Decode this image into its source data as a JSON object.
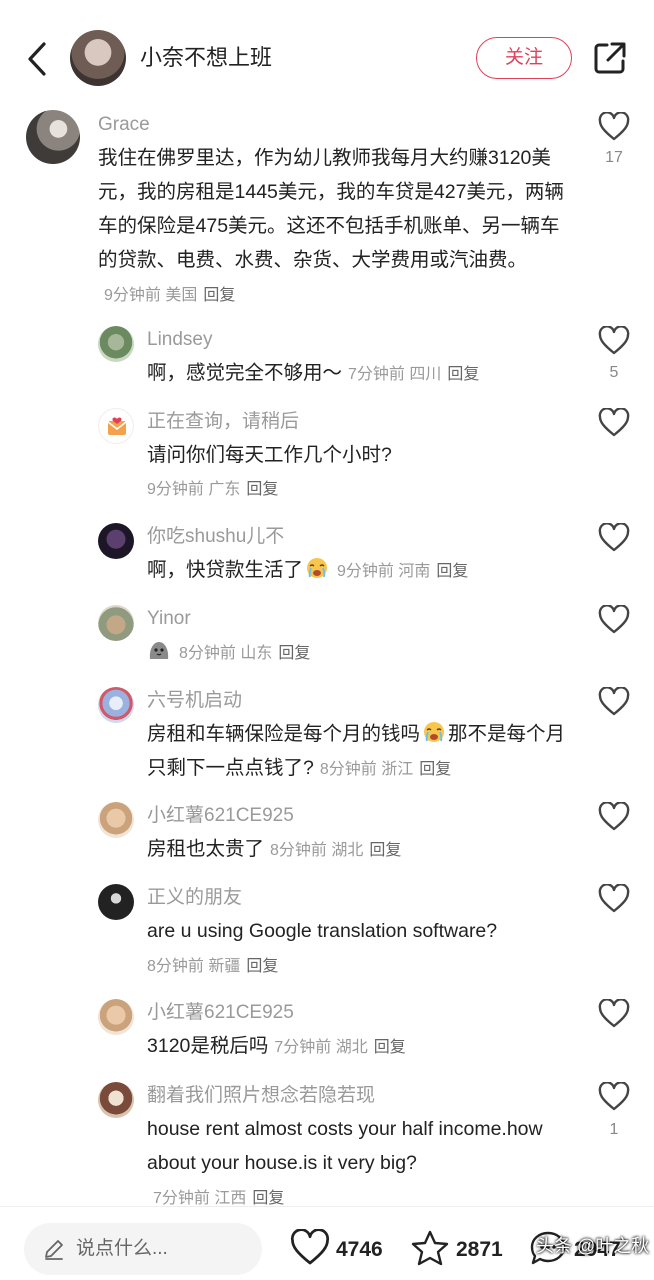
{
  "header": {
    "name": "小奈不想上班",
    "follow_label": "关注"
  },
  "comments": [
    {
      "user": "Grace",
      "text": "我住在佛罗里达，作为幼儿教师我每月大约赚3120美元，我的房租是1445美元，我的车贷是427美元，两辆车的保险是475美元。这还不包括手机账单、另一辆车的贷款、电费、水费、杂货、大学费用或汽油费。",
      "time": "9分钟前",
      "location": "美国",
      "reply": "回复",
      "likes": "17"
    },
    {
      "user": "Lindsey",
      "text": "啊，感觉完全不够用～",
      "time": "7分钟前",
      "location": "四川",
      "reply": "回复",
      "likes": "5"
    },
    {
      "user": "正在查询，请稍后",
      "text": "请问你们每天工作几个小时?",
      "time": "9分钟前",
      "location": "广东",
      "reply": "回复",
      "likes": ""
    },
    {
      "user": "你吃shushu儿不",
      "text": "啊，快贷款生活了",
      "emoji": "crying-face",
      "time": "9分钟前",
      "location": "河南",
      "reply": "回复",
      "likes": ""
    },
    {
      "user": "Yinor",
      "text": "",
      "emoji": "grey-blob",
      "time": "8分钟前",
      "location": "山东",
      "reply": "回复",
      "likes": ""
    },
    {
      "user": "六号机启动",
      "text_a": "房租和车辆保险是每个月的钱吗",
      "emoji": "crying-face",
      "text_b": "那不是每个月只剩下一点点钱了?",
      "time": "8分钟前",
      "location": "浙江",
      "reply": "回复",
      "likes": ""
    },
    {
      "user": "小红薯621CE925",
      "text": "房租也太贵了",
      "time": "8分钟前",
      "location": "湖北",
      "reply": "回复",
      "likes": ""
    },
    {
      "user": "正义的朋友",
      "text": "are u using Google translation software?",
      "time": "8分钟前",
      "location": "新疆",
      "reply": "回复",
      "likes": ""
    },
    {
      "user": "小红薯621CE925",
      "text": "3120是税后吗",
      "time": "7分钟前",
      "location": "湖北",
      "reply": "回复",
      "likes": ""
    },
    {
      "user": "翻着我们照片想念若隐若现",
      "text": "house rent almost costs your half income.how about your house.is it very big?",
      "time": "7分钟前",
      "location": "江西",
      "reply": "回复",
      "likes": "1"
    }
  ],
  "bottom": {
    "placeholder": "说点什么...",
    "likes": "4746",
    "favorites": "2871",
    "comments": "2947"
  },
  "watermark": "头条 @叶之秋",
  "icons": {
    "back": "chevron-left-icon",
    "share": "share-icon",
    "like": "heart-icon",
    "favorite": "star-icon",
    "comment": "comment-bubble-icon",
    "edit": "pen-icon"
  },
  "colors": {
    "accent": "#e1405a",
    "secondary_text": "#9a9a9a",
    "primary_text": "#222222"
  }
}
